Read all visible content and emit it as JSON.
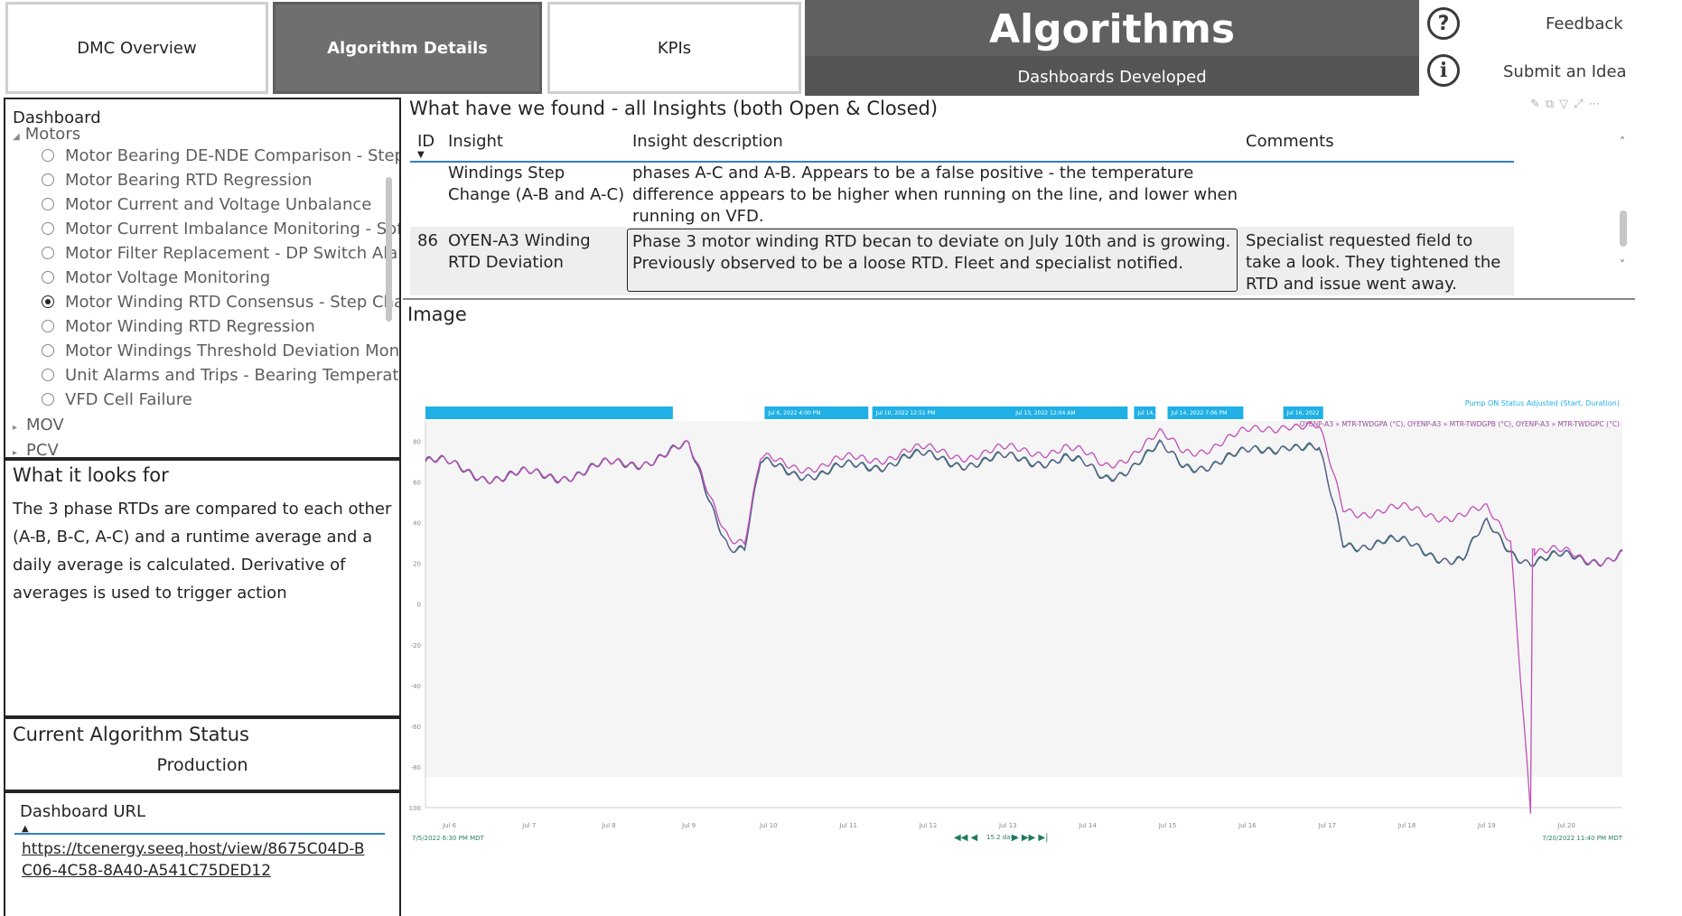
{
  "nav": {
    "tab1": "DMC Overview",
    "tab2": "Algorithm Details",
    "tab3": "KPIs",
    "title": "Algorithms",
    "subtitle": "Dashboards Developed",
    "feedback": "Feedback",
    "submit_idea": "Submit an Idea",
    "help_icon_glyph": "?",
    "info_icon_glyph": "i"
  },
  "tree": {
    "header": "Dashboard",
    "group": "Motors",
    "items": [
      "Motor Bearing DE-NDE Comparison - Step...",
      "Motor Bearing RTD Regression",
      "Motor Current and Voltage Unbalance",
      "Motor Current Imbalance Monitoring - Sof...",
      "Motor Filter Replacement - DP Switch Alarm",
      "Motor Voltage Monitoring",
      "Motor Winding RTD Consensus - Step Cha...",
      "Motor Winding RTD Regression",
      "Motor Windings Threshold Deviation Moni...",
      "Unit Alarms and Trips - Bearing Temperatu...",
      "VFD Cell Failure"
    ],
    "selected_index": 6,
    "collapsed_groups": [
      "MOV",
      "PCV"
    ]
  },
  "looks_for": {
    "title": "What it looks for",
    "body": "The 3 phase RTDs are compared to each other (A-B, B-C, A-C) and a runtime average and a daily average is calculated. Derivative of averages is used to trigger action"
  },
  "status": {
    "title": "Current Algorithm Status",
    "value": "Production"
  },
  "url": {
    "header": "Dashboard URL",
    "link": "https://tcenergy.seeq.host/view/8675C04D-BC06-4C58-8A40-A541C75DED12"
  },
  "insights": {
    "title": "What have we found - all Insights (both Open & Closed)",
    "columns": [
      "ID",
      "Insight",
      "Insight description",
      "Comments"
    ],
    "rows": [
      {
        "id": "",
        "insight": "Windings Step Change (A-B and A-C)",
        "description": "phases A-C and A-B. Appears to be a false positive - the temperature difference appears to be higher when running on the line, and lower when running on VFD.",
        "comments": ""
      },
      {
        "id": "86",
        "insight": "OYEN-A3 Winding RTD Deviation",
        "description": "Phase 3 motor winding RTD becan to deviate on July 10th and is growing. Previously observed to be a loose RTD. Fleet and specialist notified.",
        "comments": "Specialist requested field to take a look. They tightened the RTD and issue went away."
      }
    ]
  },
  "image_section": {
    "title": "Image"
  },
  "chart_data": {
    "type": "line",
    "title": "",
    "legend_top": "Pump ON Status Adjusted (Start, Duration)",
    "series_legend": "OYENP-A3 » MTR-TWDGPA (°C), OYENP-A3 » MTR-TWDGPB (°C), OYENP-A3 » MTR-TWDGPC (°C)",
    "series": [
      {
        "name": "OYENP-A3 » MTR-TWDGPA (°C)",
        "color": "#5a5a8a"
      },
      {
        "name": "OYENP-A3 » MTR-TWDGPB (°C)",
        "color": "#2e8b6e"
      },
      {
        "name": "OYENP-A3 » MTR-TWDGPC (°C)",
        "color": "#c050b8"
      }
    ],
    "x_ticks": [
      "Jul 6",
      "Jul 7",
      "Jul 8",
      "Jul 9",
      "Jul 10",
      "Jul 11",
      "Jul 12",
      "Jul 13",
      "Jul 14",
      "Jul 15",
      "Jul 16",
      "Jul 17",
      "Jul 18",
      "Jul 19",
      "Jul 20"
    ],
    "y_ticks": [
      80,
      60,
      40,
      20,
      0,
      -20,
      -40,
      -60,
      -80,
      -100
    ],
    "ylim": [
      -100,
      90
    ],
    "capsule_labels": [
      "Jul 6, 2022 4:00 PM",
      "Jul 10, 2022 12:51 PM",
      "Jul 13, 2022 12:04 AM",
      "Jul 14,",
      "Jul 14, 2022 7:06 PM",
      "Jul 16, 2022"
    ],
    "x_start_label": "7/5/2022 6:30 PM MDT",
    "x_end_label": "7/20/2022 11:40 PM MDT",
    "range_label": "15.2 days",
    "key_points_magenta": [
      [
        0,
        70
      ],
      [
        1,
        62
      ],
      [
        2,
        65
      ],
      [
        3.3,
        76
      ],
      [
        3.8,
        35
      ],
      [
        4.0,
        30
      ],
      [
        4.2,
        70
      ],
      [
        5.0,
        68
      ],
      [
        6.0,
        75
      ],
      [
        7.0,
        74
      ],
      [
        8.0,
        77
      ],
      [
        8.5,
        68
      ],
      [
        9.2,
        82
      ],
      [
        9.5,
        75
      ],
      [
        10.2,
        82
      ],
      [
        10.8,
        90
      ],
      [
        11.2,
        85
      ],
      [
        11.5,
        47
      ],
      [
        12.0,
        46
      ],
      [
        13.0,
        44
      ],
      [
        13.3,
        45
      ],
      [
        13.6,
        32
      ],
      [
        13.85,
        -100
      ],
      [
        13.9,
        27
      ],
      [
        14.5,
        22
      ],
      [
        15.0,
        25
      ]
    ],
    "key_points_green": [
      [
        0,
        70
      ],
      [
        1,
        62
      ],
      [
        2,
        65
      ],
      [
        3.3,
        76
      ],
      [
        3.8,
        30
      ],
      [
        4.0,
        27
      ],
      [
        4.2,
        68
      ],
      [
        5.0,
        64
      ],
      [
        6.0,
        72
      ],
      [
        7.0,
        70
      ],
      [
        8.0,
        72
      ],
      [
        8.5,
        62
      ],
      [
        9.2,
        76
      ],
      [
        9.5,
        68
      ],
      [
        10.2,
        72
      ],
      [
        10.8,
        80
      ],
      [
        11.2,
        74
      ],
      [
        11.5,
        30
      ],
      [
        12.0,
        31
      ],
      [
        13.0,
        22
      ],
      [
        13.3,
        38
      ],
      [
        13.6,
        27
      ],
      [
        13.85,
        22
      ],
      [
        14.5,
        22
      ],
      [
        15.0,
        25
      ]
    ]
  },
  "colors": {
    "active_tab": "#6f6f6f",
    "title_bg": "#606060",
    "capsule": "#1fb0e6",
    "link": "#252423"
  }
}
